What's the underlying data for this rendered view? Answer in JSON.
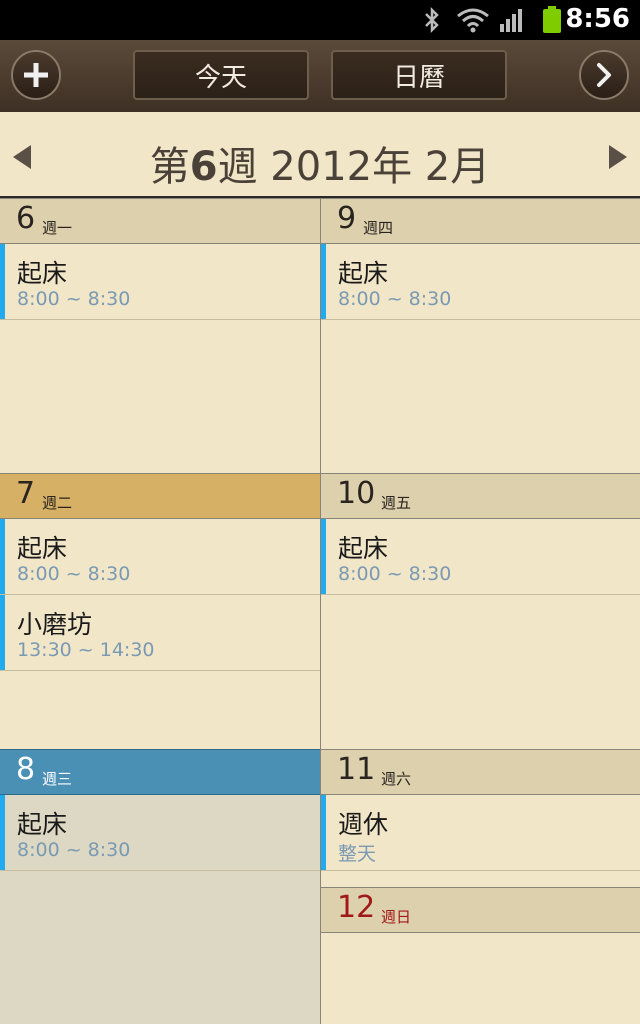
{
  "status_bar": {
    "time": "8:56"
  },
  "toolbar": {
    "today_label": "今天",
    "calendar_label": "日曆"
  },
  "week_header": {
    "prefix": "第",
    "week_number": "6",
    "suffix": "週 2012年 2月"
  },
  "days": [
    {
      "num": "6",
      "weekday": "週一"
    },
    {
      "num": "7",
      "weekday": "週二"
    },
    {
      "num": "8",
      "weekday": "週三"
    },
    {
      "num": "9",
      "weekday": "週四"
    },
    {
      "num": "10",
      "weekday": "週五"
    },
    {
      "num": "11",
      "weekday": "週六"
    },
    {
      "num": "12",
      "weekday": "週日"
    }
  ],
  "events": [
    {
      "title": "起床",
      "time": "8:00 ~ 8:30"
    },
    {
      "title": "起床",
      "time": "8:00 ~ 8:30"
    },
    {
      "title": "小磨坊",
      "time": "13:30 ~ 14:30"
    },
    {
      "title": "起床",
      "time": "8:00 ~ 8:30"
    },
    {
      "title": "起床",
      "time": "8:00 ~ 8:30"
    },
    {
      "title": "起床",
      "time": "8:00 ~ 8:30"
    },
    {
      "title": "週休",
      "time": "整天"
    }
  ],
  "colors": {
    "accent_event_bar": "#22aaee",
    "today_highlight": "#d6b064",
    "selected_day": "#4a90b4",
    "sunday_red": "#a01818"
  },
  "icons": [
    "add-icon",
    "chevron-right-icon",
    "prev-week-arrow-icon",
    "next-week-arrow-icon",
    "bluetooth-icon",
    "wifi-icon",
    "signal-icon",
    "battery-icon"
  ]
}
